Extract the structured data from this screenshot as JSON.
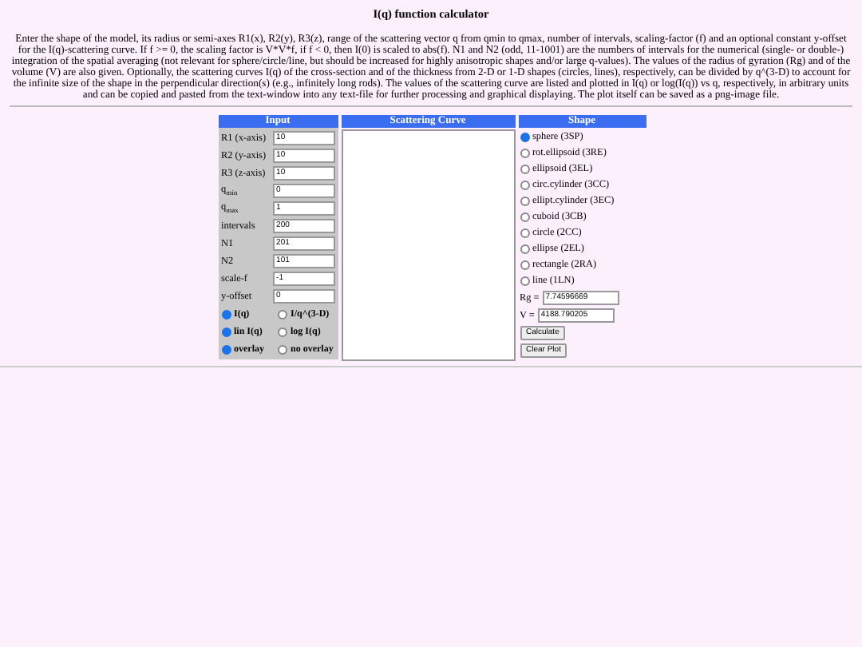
{
  "title": "I(q) function calculator",
  "description": "Enter the shape of the model, its radius or semi-axes R1(x), R2(y), R3(z), range of the scattering vector q from qmin to qmax, number of intervals, scaling-factor (f) and an optional constant y-offset for the I(q)-scattering curve. If f >= 0, the scaling factor is V*V*f, if f < 0, then I(0) is scaled to abs(f). N1 and N2 (odd, 11-1001) are the numbers of intervals for the numerical (single- or double-) integration of the spatial averaging (not relevant for sphere/circle/line, but should be increased for highly anisotropic shapes and/or large q-values). The values of the radius of gyration (Rg) and of the volume (V) are also given. Optionally, the scattering curves I(q) of the cross-section and of the thickness from 2-D or 1-D shapes (circles, lines), respectively, can be divided by q^(3-D) to account for the infinite size of the shape in the perpendicular direction(s) (e.g., infinitely long rods). The values of the scattering curve are listed and plotted in I(q) or log(I(q)) vs q, respectively, in arbitrary units and can be copied and pasted from the text-window into any text-file for further processing and graphical displaying. The plot itself can be saved as a png-image file.",
  "input": {
    "header": "Input",
    "fields": [
      {
        "label": "R1 (x-axis)",
        "value": "10"
      },
      {
        "label": "R2 (y-axis)",
        "value": "10"
      },
      {
        "label": "R3 (z-axis)",
        "value": "10"
      },
      {
        "label": "q$_{min}$",
        "value": "0"
      },
      {
        "label": "q$_{max}$",
        "value": "1"
      },
      {
        "label": "intervals",
        "value": "200"
      },
      {
        "label": "N1",
        "value": "201"
      },
      {
        "label": "N2",
        "value": "101"
      },
      {
        "label": "scale-f",
        "value": "-1"
      },
      {
        "label": "y-offset",
        "value": "0"
      }
    ],
    "radio_groups": [
      [
        {
          "label": "I(q)",
          "selected": true
        },
        {
          "label": "I/q^(3-D)",
          "selected": false
        }
      ],
      [
        {
          "label": "lin I(q)",
          "selected": true
        },
        {
          "label": "log I(q)",
          "selected": false
        }
      ],
      [
        {
          "label": "overlay",
          "selected": true
        },
        {
          "label": "no overlay",
          "selected": false
        }
      ]
    ]
  },
  "scattering_curve": {
    "header": "Scattering Curve"
  },
  "shape": {
    "header": "Shape",
    "options": [
      {
        "label": "sphere (3SP)",
        "selected": true
      },
      {
        "label": "rot.ellipsoid (3RE)",
        "selected": false
      },
      {
        "label": "ellipsoid (3EL)",
        "selected": false
      },
      {
        "label": "circ.cylinder (3CC)",
        "selected": false
      },
      {
        "label": "ellipt.cylinder (3EC)",
        "selected": false
      },
      {
        "label": "cuboid (3CB)",
        "selected": false
      },
      {
        "label": "circle (2CC)",
        "selected": false
      },
      {
        "label": "ellipse (2EL)",
        "selected": false
      },
      {
        "label": "rectangle (2RA)",
        "selected": false
      },
      {
        "label": "line (1LN)",
        "selected": false
      }
    ],
    "results": [
      {
        "label": "Rg =",
        "value": "7.74596669"
      },
      {
        "label": "V =",
        "value": "4188.790205"
      }
    ],
    "buttons": [
      "Calculate",
      "Clear Plot"
    ]
  }
}
